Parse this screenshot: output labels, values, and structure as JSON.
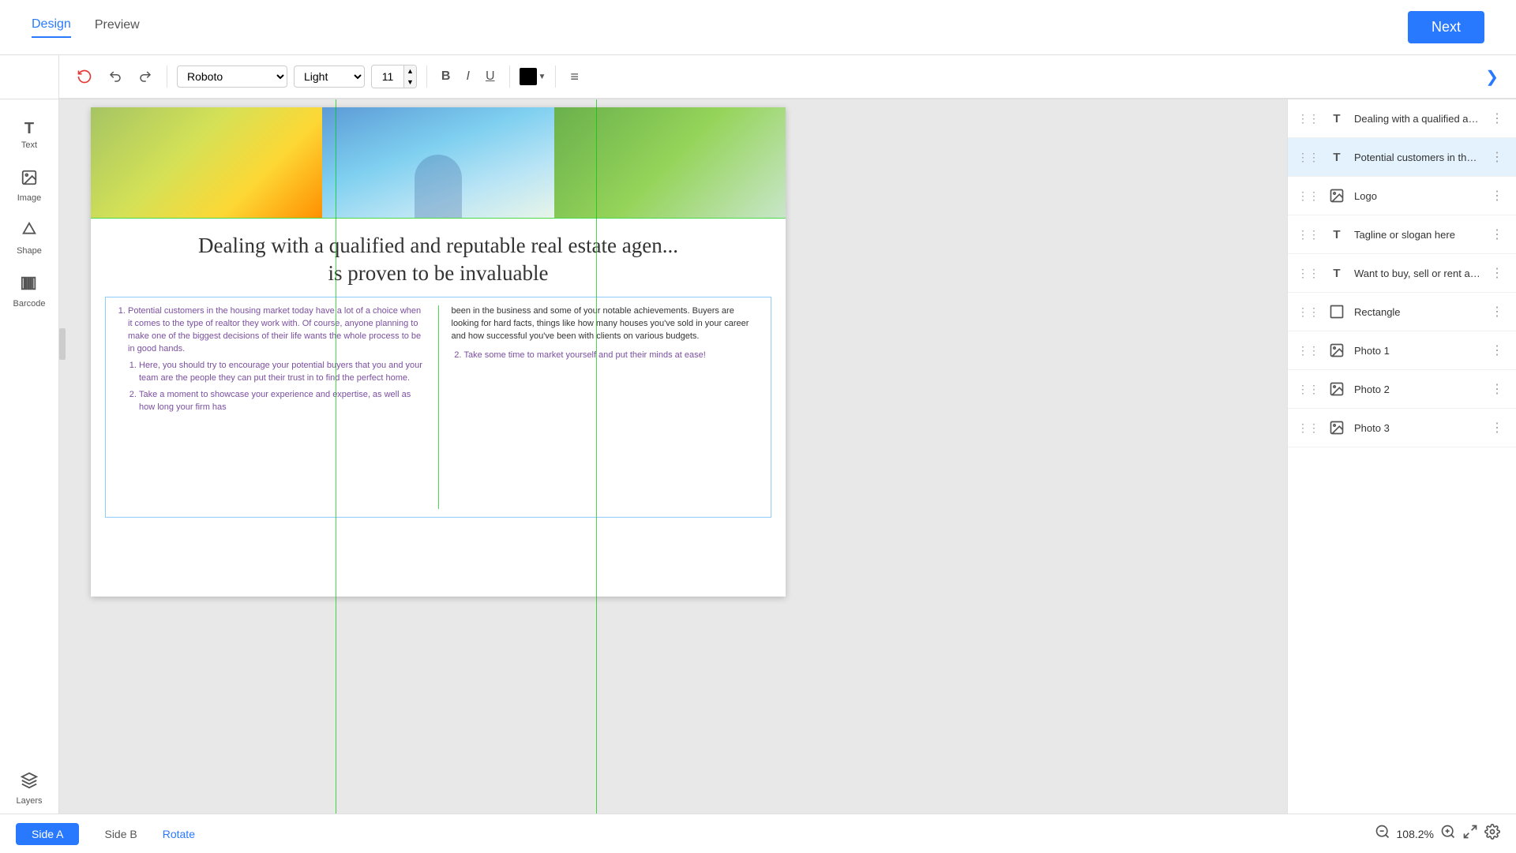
{
  "header": {
    "tabs": [
      {
        "id": "design",
        "label": "Design",
        "active": true
      },
      {
        "id": "preview",
        "label": "Preview",
        "active": false
      }
    ],
    "next_button": "Next"
  },
  "toolbar": {
    "undo_label": "↩",
    "redo_label": "↪",
    "font_family": "Roboto",
    "font_weight": "Light",
    "font_size": "11",
    "bold_label": "B",
    "italic_label": "I",
    "underline_label": "U",
    "color_label": "",
    "align_label": "≡",
    "chevron_label": "❯"
  },
  "left_sidebar": {
    "items": [
      {
        "id": "text",
        "icon": "T",
        "label": "Text"
      },
      {
        "id": "image",
        "icon": "🖼",
        "label": "Image"
      },
      {
        "id": "shape",
        "icon": "⬡",
        "label": "Shape"
      },
      {
        "id": "barcode",
        "icon": "▦",
        "label": "Barcode"
      }
    ],
    "bottom_items": [
      {
        "id": "layers",
        "icon": "⊞",
        "label": "Layers"
      }
    ]
  },
  "slide": {
    "title": "Dealing with a qualified and reputable real estate agent\nis proven to be invaluable",
    "col1_items": [
      "Potential customers in the housing market today have a lot of a choice when it comes to the type of realtor they work with. Of course, anyone planning to make one of the biggest decisions of their life wants the whole process to be in good hands.",
      "Here, you should try to encourage your potential buyers that you and your team are the people they can put their trust in to find the perfect home.",
      "Take a moment to showcase your experience and expertise, as well as how long your firm has"
    ],
    "col2_items": [
      "been in the business and some of your notable achievements. Buyers are looking for hard facts, things like how many houses you've sold in your career and how successful you've been with clients on various budgets.",
      "Take some time to market yourself and put their minds at ease!"
    ]
  },
  "layers_panel": {
    "items": [
      {
        "id": "layer1",
        "type": "text",
        "name": "Dealing with a qualified and reputable real estate agent is proven to be invaluable",
        "selected": false
      },
      {
        "id": "layer2",
        "type": "text",
        "name": "Potential customers in the housing ...",
        "selected": true
      },
      {
        "id": "layer3",
        "type": "image",
        "name": "Logo",
        "selected": false
      },
      {
        "id": "layer4",
        "type": "text",
        "name": "Tagline or slogan here",
        "selected": false
      },
      {
        "id": "layer5",
        "type": "text",
        "name": "Want to buy, sell or rent a property?",
        "selected": false
      },
      {
        "id": "layer6",
        "type": "shape",
        "name": "Rectangle",
        "selected": false
      },
      {
        "id": "layer7",
        "type": "image",
        "name": "Photo 1",
        "selected": false
      },
      {
        "id": "layer8",
        "type": "image",
        "name": "Photo 2",
        "selected": false
      },
      {
        "id": "layer9",
        "type": "image",
        "name": "Photo 3",
        "selected": false
      }
    ]
  },
  "bottom_bar": {
    "side_a": "Side A",
    "side_b": "Side B",
    "rotate": "Rotate",
    "zoom_level": "108.2%"
  },
  "colors": {
    "accent": "#2979ff",
    "text_purple": "#7b4fa0",
    "border_blue": "#90caf9"
  }
}
